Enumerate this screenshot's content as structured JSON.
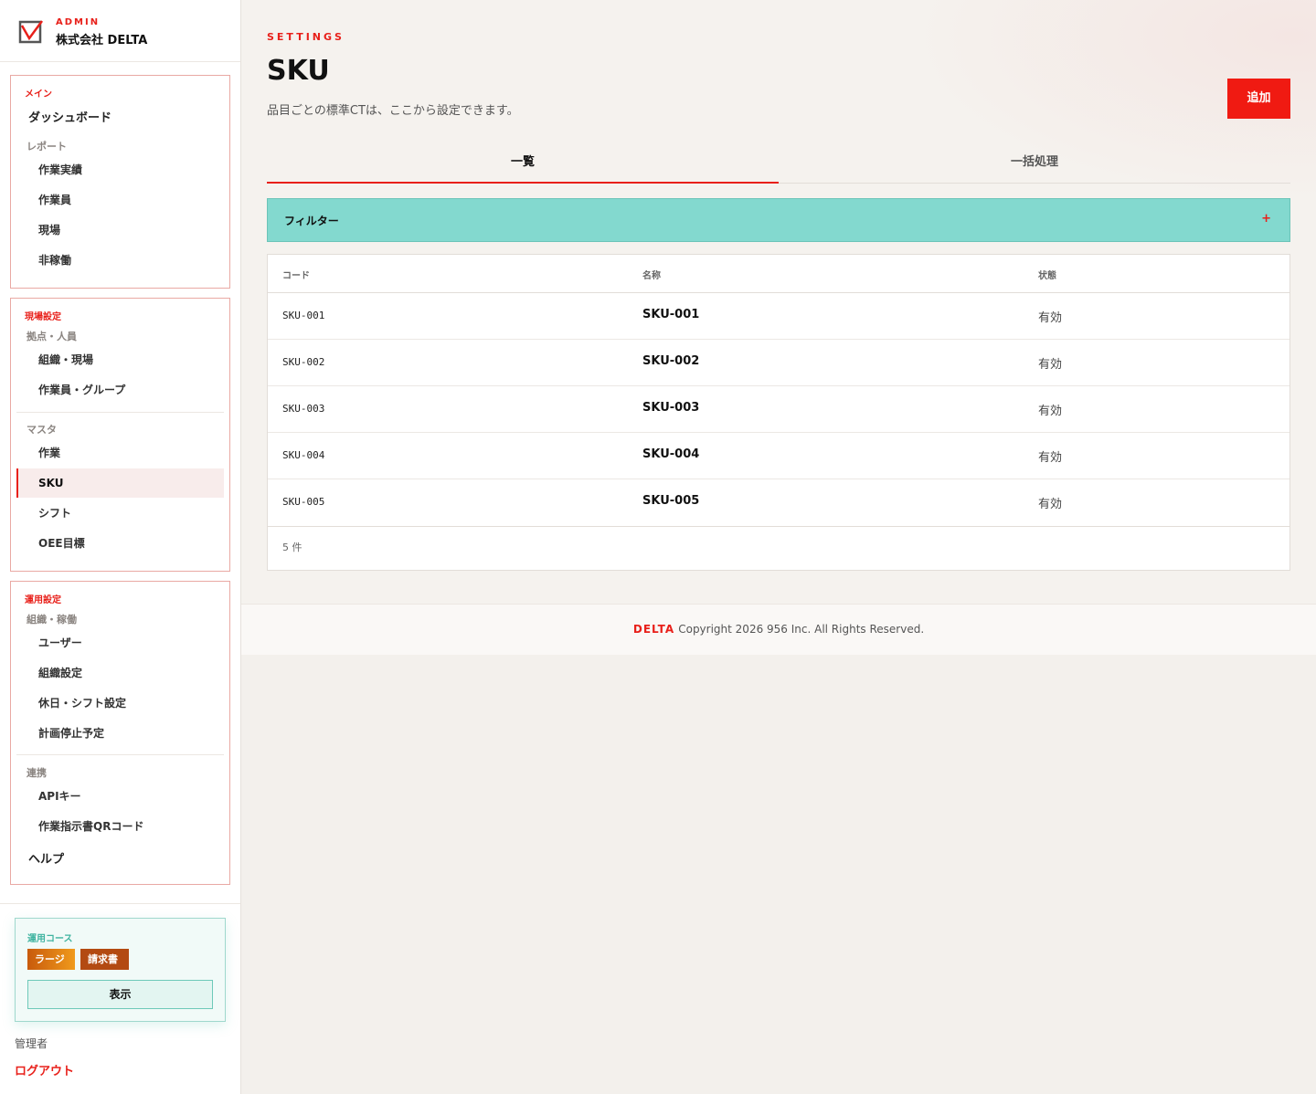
{
  "brand": {
    "admin_label": "ADMIN",
    "company": "株式会社 DELTA"
  },
  "sidebar": {
    "main": {
      "section": "メイン",
      "dashboard": "ダッシュボード",
      "reports_group": "レポート",
      "reports": [
        "作業実績",
        "作業員",
        "現場",
        "非稼働"
      ]
    },
    "site": {
      "section": "現場設定",
      "bases_group": "拠点・人員",
      "bases": [
        "組織・現場",
        "作業員・グループ"
      ],
      "master_group": "マスタ",
      "master": [
        "作業",
        "SKU",
        "シフト",
        "OEE目標"
      ]
    },
    "ops": {
      "section": "運用設定",
      "org_group": "組織・稼働",
      "org": [
        "ユーザー",
        "組織設定",
        "休日・シフト設定",
        "計画停止予定"
      ],
      "link_group": "連携",
      "link": [
        "APIキー",
        "作業指示書QRコード"
      ],
      "help": "ヘルプ"
    },
    "plan": {
      "title": "運用コース",
      "badges": [
        "ラージ",
        "請求書"
      ],
      "button": "表示"
    },
    "role": "管理者",
    "logout": "ログアウト"
  },
  "page": {
    "eyebrow": "SETTINGS",
    "title": "SKU",
    "description": "品目ごとの標準CTは、ここから設定できます。",
    "add_button": "追加",
    "tabs": [
      "一覧",
      "一括処理"
    ],
    "filter_label": "フィルター",
    "filter_toggle": "+"
  },
  "table": {
    "columns": [
      "コード",
      "名称",
      "状態"
    ],
    "rows": [
      {
        "code": "SKU-001",
        "name": "SKU-001",
        "status": "有効"
      },
      {
        "code": "SKU-002",
        "name": "SKU-002",
        "status": "有効"
      },
      {
        "code": "SKU-003",
        "name": "SKU-003",
        "status": "有効"
      },
      {
        "code": "SKU-004",
        "name": "SKU-004",
        "status": "有効"
      },
      {
        "code": "SKU-005",
        "name": "SKU-005",
        "status": "有効"
      }
    ],
    "count": "5 件"
  },
  "footer": {
    "brand": "DELTA",
    "copyright": "Copyright 2026 956 Inc. All Rights Reserved."
  },
  "colors": {
    "accent": "#e8201a",
    "teal": "#83d9cf",
    "active_bg": "#f8eceb"
  }
}
